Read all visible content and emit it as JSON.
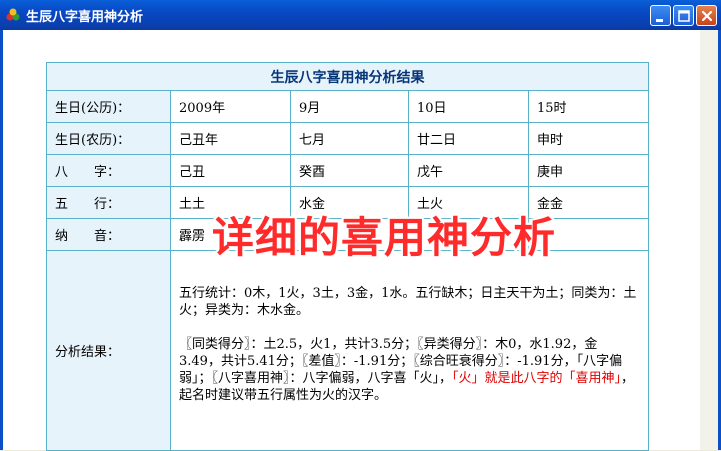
{
  "window": {
    "title": "生辰八字喜用神分析"
  },
  "table": {
    "title": "生辰八字喜用神分析结果",
    "rows": [
      {
        "label": "生日(公历)：",
        "cells": [
          "2009年",
          "9月",
          "10日",
          "15时"
        ]
      },
      {
        "label": "生日(农历)：",
        "cells": [
          "己丑年",
          "七月",
          "廿二日",
          "申时"
        ]
      },
      {
        "label": "八　　字：",
        "cells": [
          "己丑",
          "癸酉",
          "戊午",
          "庚申"
        ]
      },
      {
        "label": "五　　行：",
        "cells": [
          "土土",
          "水金",
          "土火",
          "金金"
        ]
      },
      {
        "label": "纳　　音：",
        "cells": [
          "霹雳",
          "",
          "",
          ""
        ]
      }
    ],
    "result_label": "分析结果：",
    "result_p1": "五行统计：0木，1火，3土，3金，1水。五行缺木；日主天干为土；同类为：土火；异类为：木水金。",
    "result_p2_a": "〖同类得分〗：土2.5，火1，共计3.5分；〖异类得分〗：木0，水1.92，金3.49，共计5.41分；〖差值〗：-1.91分；〖综合旺衰得分〗：-1.91分，「八字偏弱」；〖八字喜用神〗：八字偏弱，八字喜「火」，",
    "result_p2_red": "「火」就是此八字的「喜用神」",
    "result_p2_b": "，起名时建议带五行属性为火的汉字。"
  },
  "overlay_caption": "详细的喜用神分析",
  "colors": {
    "titlebar": "#0a5fd8",
    "border": "#59b0c9",
    "label_bg": "#e7f3fb",
    "highlight": "#e00000"
  }
}
